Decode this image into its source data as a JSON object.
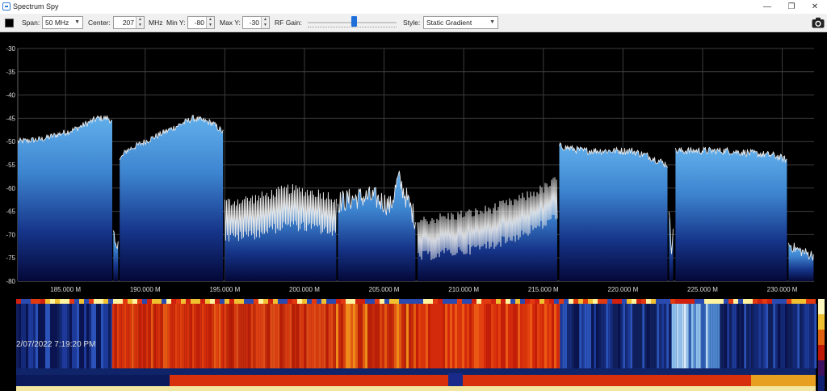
{
  "window": {
    "title": "Spectrum Spy",
    "controls": [
      "—",
      "❐",
      "✕"
    ]
  },
  "toolbar": {
    "span_label": "Span:",
    "span_value": "50 MHz",
    "center_label": "Center:",
    "center_value": "207",
    "center_unit": "MHz",
    "miny_label": "Min Y:",
    "miny_value": "-80",
    "maxy_label": "Max Y:",
    "maxy_value": "-30",
    "rfgain_label": "RF Gain:",
    "rfgain_level": 0.52,
    "style_label": "Style:",
    "style_value": "Static Gradient"
  },
  "colors": {
    "trace": "#e8e8e8",
    "fill_top": "#5fa8e6",
    "fill_bottom": "#050a3a",
    "grid": "#3c3c3c"
  },
  "chart_data": {
    "type": "area",
    "ylim": [
      -80,
      -30
    ],
    "xlim": [
      182.0,
      232.0
    ],
    "y_ticks": [
      "-30",
      "-35",
      "-40",
      "-45",
      "-50",
      "-55",
      "-60",
      "-65",
      "-70",
      "-75",
      "-80"
    ],
    "x_ticks": [
      "185.000 M",
      "190.000 M",
      "195.000 M",
      "200.000 M",
      "205.000 M",
      "210.000 M",
      "215.000 M",
      "220.000 M",
      "225.000 M",
      "230.000 M"
    ],
    "segments": [
      {
        "x": [
          182.0,
          183.5,
          185.5,
          187.0,
          187.7,
          187.95
        ],
        "y": [
          -50,
          -49.5,
          -47.5,
          -45,
          -45,
          -46
        ],
        "noise": 0.7
      },
      {
        "x": [
          188.0,
          188.15,
          188.35
        ],
        "y": [
          -70,
          -73,
          -70
        ],
        "noise": 1.5
      },
      {
        "x": [
          188.4,
          188.8,
          190.0,
          191.5,
          193.0,
          194.2,
          194.9
        ],
        "y": [
          -54,
          -52,
          -50,
          -47.5,
          -45,
          -46,
          -48
        ],
        "noise": 0.7
      },
      {
        "x": [
          195.0,
          197.0,
          199.0,
          201.0,
          202.0
        ],
        "y": [
          -67,
          -66,
          -64,
          -65,
          -66
        ],
        "noise": 5
      },
      {
        "x": [
          202.1,
          203.5,
          204.3,
          205.0,
          205.4,
          205.9,
          206.5,
          207.0
        ],
        "y": [
          -63,
          -62,
          -62,
          -63,
          -64,
          -58,
          -63,
          -67
        ],
        "noise": 2.5
      },
      {
        "x": [
          207.1,
          209.0,
          211.0,
          213.0,
          215.0,
          215.9
        ],
        "y": [
          -71,
          -70,
          -69,
          -67,
          -64,
          -62
        ],
        "noise": 5
      },
      {
        "x": [
          216.0,
          217.5,
          219.0,
          220.5,
          221.5,
          222.8
        ],
        "y": [
          -51,
          -52,
          -52,
          -52,
          -53,
          -55
        ],
        "noise": 0.8
      },
      {
        "x": [
          222.9,
          223.05,
          223.2
        ],
        "y": [
          -66,
          -73,
          -66
        ],
        "noise": 1.5
      },
      {
        "x": [
          223.3,
          225.0,
          226.5,
          228.0,
          229.5,
          230.3
        ],
        "y": [
          -52,
          -52,
          -52,
          -52.5,
          -53,
          -54
        ],
        "noise": 0.8
      },
      {
        "x": [
          230.4,
          230.8,
          231.5,
          232.0
        ],
        "y": [
          -72,
          -73,
          -74,
          -74.5
        ],
        "noise": 1.2
      }
    ]
  },
  "waterfall": {
    "timestamp": "2/07/2022 7:19:20 PM",
    "bands": [
      {
        "x": [
          182,
          188
        ],
        "type": "blue"
      },
      {
        "x": [
          188,
          195
        ],
        "type": "red"
      },
      {
        "x": [
          195,
          202
        ],
        "type": "red2"
      },
      {
        "x": [
          202,
          207
        ],
        "type": "orange"
      },
      {
        "x": [
          207,
          216
        ],
        "type": "red"
      },
      {
        "x": [
          216,
          223
        ],
        "type": "blue"
      },
      {
        "x": [
          223,
          226
        ],
        "type": "light"
      },
      {
        "x": [
          226,
          232
        ],
        "type": "blue"
      }
    ]
  }
}
